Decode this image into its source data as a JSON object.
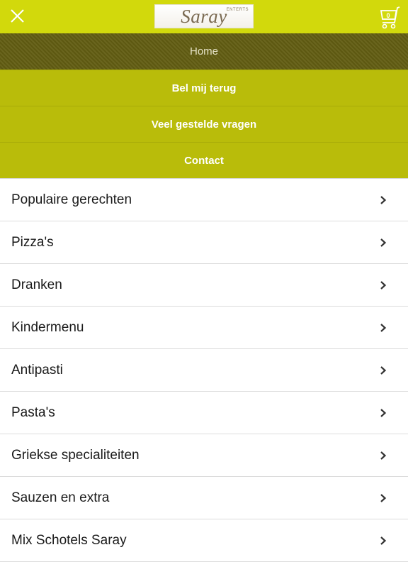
{
  "header": {
    "close_icon": "close-icon",
    "logo_text": "Saray",
    "logo_subtext": "ENTERTS",
    "cart_icon": "shopping-cart-icon",
    "cart_count": "0",
    "background_color": "#d2d90c"
  },
  "nav_menu": {
    "items": [
      {
        "label": "Home",
        "active": true
      },
      {
        "label": "Bel mij terug"
      },
      {
        "label": "Veel gestelde vragen"
      },
      {
        "label": "Contact"
      }
    ],
    "active_color": "#625d12",
    "item_color": "#b9bc0a"
  },
  "categories": {
    "chevron_icon": "chevron-right-icon",
    "items": [
      {
        "label": "Populaire gerechten"
      },
      {
        "label": "Pizza's"
      },
      {
        "label": "Dranken"
      },
      {
        "label": "Kindermenu"
      },
      {
        "label": "Antipasti"
      },
      {
        "label": "Pasta's"
      },
      {
        "label": "Griekse specialiteiten"
      },
      {
        "label": "Sauzen en extra"
      },
      {
        "label": "Mix Schotels Saray"
      }
    ]
  }
}
